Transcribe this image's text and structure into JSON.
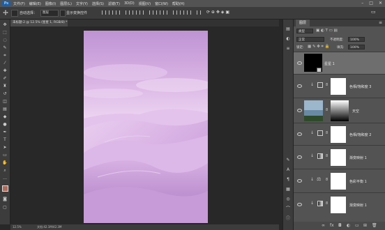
{
  "menu": {
    "logo": "Ps",
    "items": [
      "文件(F)",
      "编辑(E)",
      "图像(I)",
      "图层(L)",
      "文字(Y)",
      "选择(S)",
      "滤镜(T)",
      "3D(D)",
      "视图(V)",
      "窗口(W)",
      "帮助(H)"
    ]
  },
  "options": {
    "auto_select_label": "自动选择：",
    "auto_select_value": "图层",
    "transform_label": "显示变换控件"
  },
  "document": {
    "tab_title": "未标题-2 @ 12.5% (星星 1, RGB/8) *"
  },
  "status": {
    "zoom": "12.5%",
    "doc_info": "文档:42.1M/42.3M"
  },
  "panel": {
    "tab": "图层",
    "kind_label": "类型",
    "blend_mode": "正常",
    "opacity_label": "不透明度:",
    "opacity_value": "100%",
    "lock_label": "锁定:",
    "fill_label": "填充:",
    "fill_value": "100%"
  },
  "layers": [
    {
      "name": "星星 1",
      "type": "pixel",
      "selected": true
    },
    {
      "name": "色相/饱和度 3",
      "type": "adjustment",
      "clipped": true
    },
    {
      "name": "天空",
      "type": "smart",
      "clipped": false
    },
    {
      "name": "色相/饱和度 2",
      "type": "adjustment",
      "clipped": true
    },
    {
      "name": "渐变映射 1",
      "type": "adjustment",
      "clipped": true
    },
    {
      "name": "色彩平衡 1",
      "type": "adjustment",
      "clipped": true
    },
    {
      "name": "渐变映射 1",
      "type": "adjustment",
      "clipped": true
    }
  ],
  "colors": {
    "chrome": "#535353",
    "dark": "#3c3c3c",
    "canvas_bg": "#282828",
    "sky_top": "#c99ad6",
    "dune_light": "#e8c9ee",
    "dune_shadow": "#b07fc6"
  }
}
